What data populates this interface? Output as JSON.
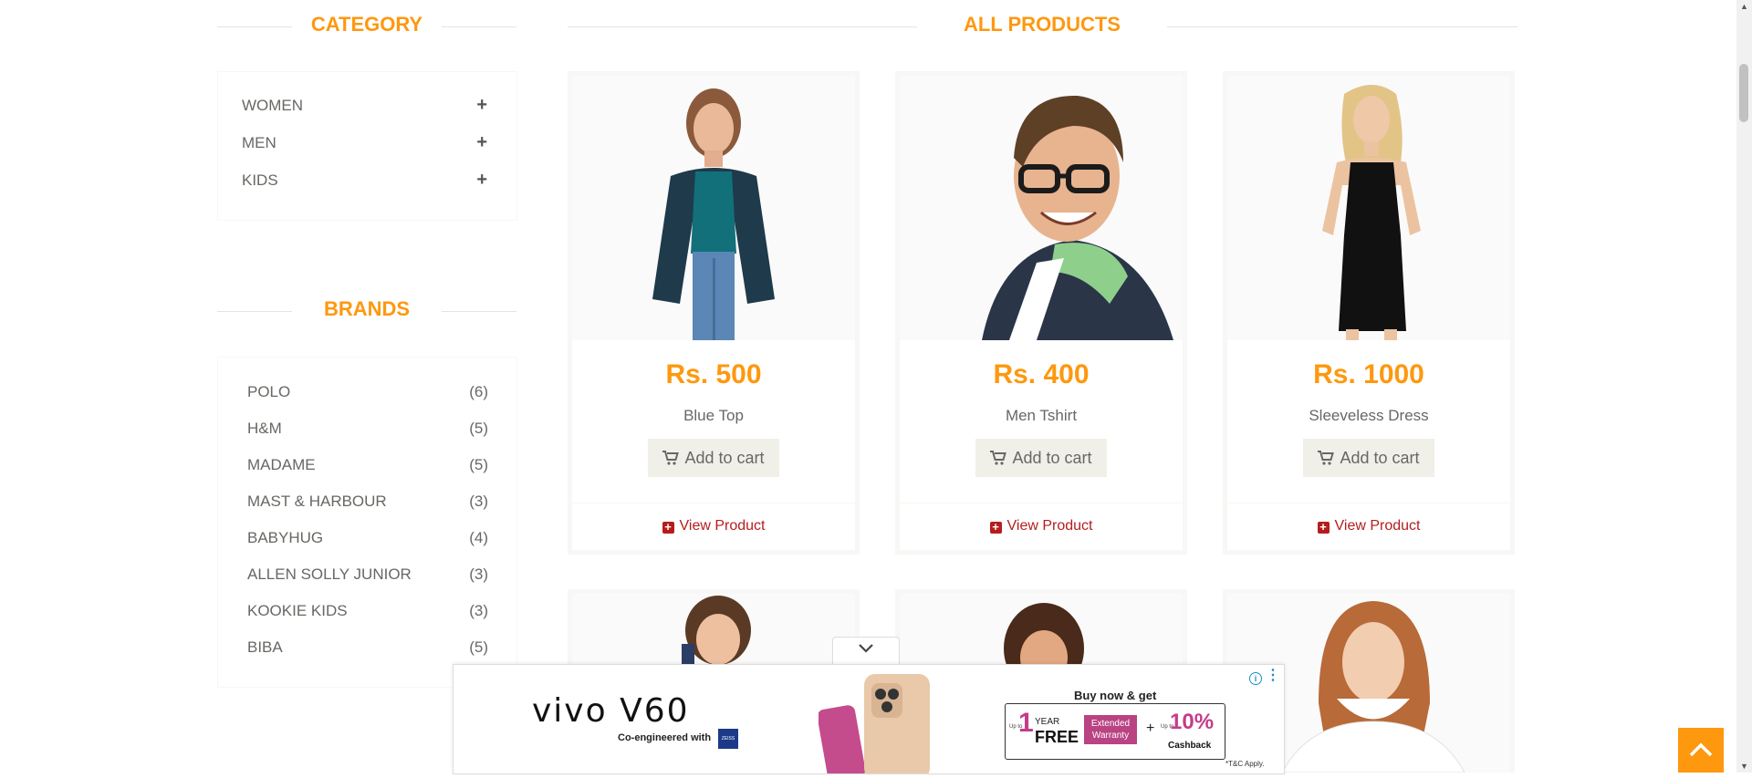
{
  "category": {
    "title": "CATEGORY",
    "items": [
      {
        "label": "WOMEN"
      },
      {
        "label": "MEN"
      },
      {
        "label": "KIDS"
      }
    ]
  },
  "brands": {
    "title": "BRANDS",
    "items": [
      {
        "label": "POLO",
        "count": "(6)"
      },
      {
        "label": "H&M",
        "count": "(5)"
      },
      {
        "label": "MADAME",
        "count": "(5)"
      },
      {
        "label": "MAST & HARBOUR",
        "count": "(3)"
      },
      {
        "label": "BABYHUG",
        "count": "(4)"
      },
      {
        "label": "ALLEN SOLLY JUNIOR",
        "count": "(3)"
      },
      {
        "label": "KOOKIE KIDS",
        "count": "(3)"
      },
      {
        "label": "BIBA",
        "count": "(5)"
      }
    ]
  },
  "products": {
    "title": "ALL PRODUCTS",
    "items": [
      {
        "price": "Rs. 500",
        "name": "Blue Top",
        "cart_label": "Add to cart",
        "view_label": "View Product"
      },
      {
        "price": "Rs. 400",
        "name": "Men Tshirt",
        "cart_label": "Add to cart",
        "view_label": "View Product"
      },
      {
        "price": "Rs. 1000",
        "name": "Sleeveless Dress",
        "cart_label": "Add to cart",
        "view_label": "View Product"
      }
    ]
  },
  "ad": {
    "brand": "vivo V60",
    "tagline": "Co-engineered with",
    "partner": "ZEISS",
    "offer_head": "Buy now & get",
    "offer_year": "YEAR",
    "offer_up_to": "Up to",
    "offer_one": "1",
    "offer_free": "FREE",
    "offer_warranty_1": "Extended",
    "offer_warranty_2": "Warranty",
    "offer_plus": "+",
    "offer_upto2": "Up to",
    "offer_pct": "10%",
    "offer_cashback": "Cashback",
    "tnc": "*T&C Apply."
  },
  "colors": {
    "accent": "#fe980f",
    "link": "#b51d1d",
    "text": "#696763"
  }
}
